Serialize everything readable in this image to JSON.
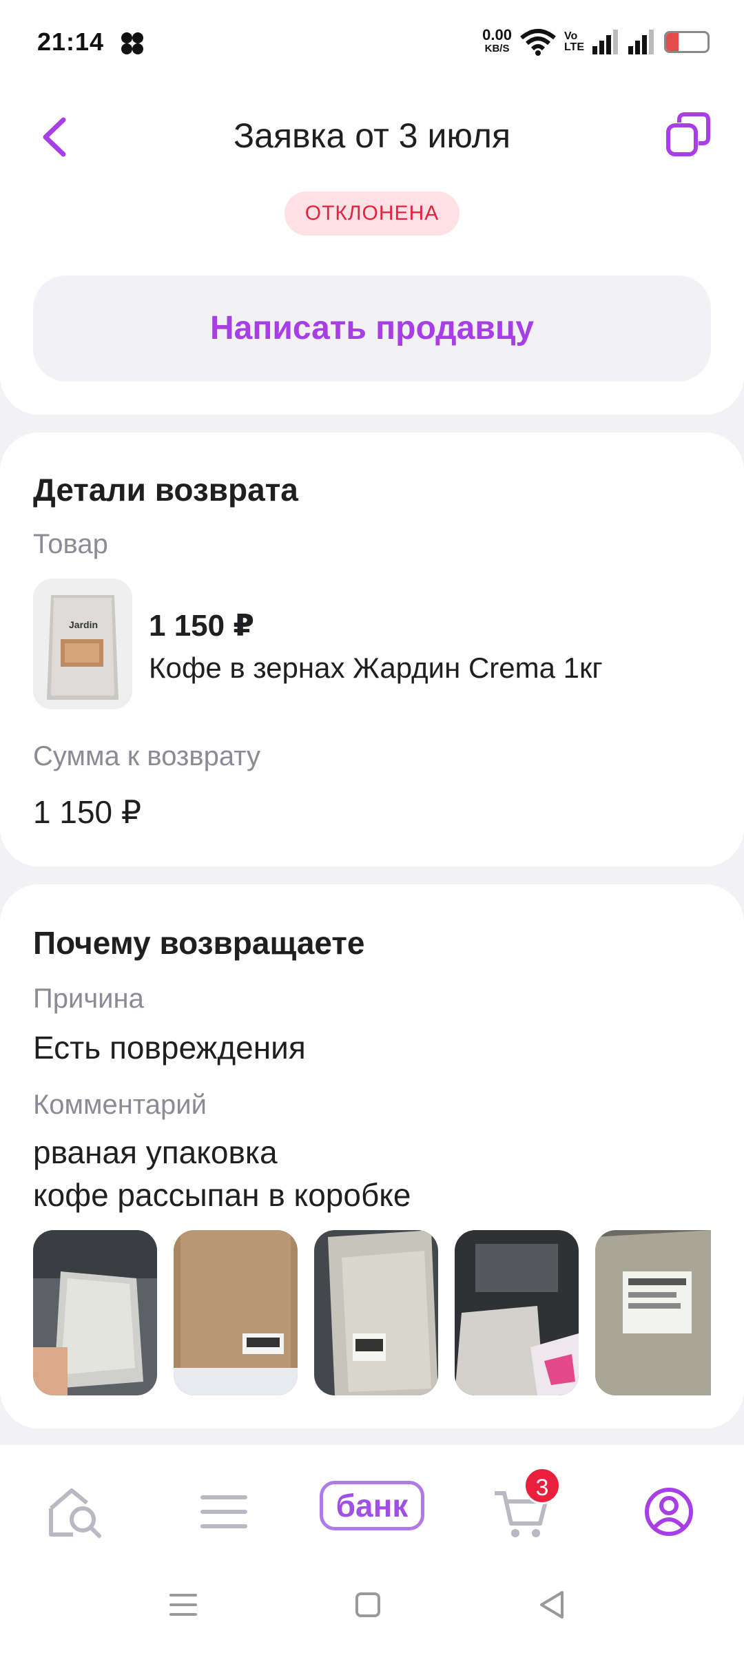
{
  "status_bar": {
    "time": "21:14",
    "net_speed": "0.00",
    "net_unit": "KB/S",
    "volte_top": "Vo",
    "volte_bottom": "LTE",
    "battery": "17"
  },
  "header": {
    "title": "Заявка от 3 июля",
    "status_badge": "ОТКЛОНЕНА",
    "write_seller_button": "Написать продавцу"
  },
  "return_details": {
    "title": "Детали возврата",
    "product_label": "Товар",
    "product_price": "1 150 ₽",
    "product_name": "Кофе в зернах Жардин Crema 1кг",
    "product_brand": "Jardin",
    "refund_label": "Сумма к возврату",
    "refund_amount": "1 150 ₽"
  },
  "reason": {
    "title": "Почему возвращаете",
    "reason_label": "Причина",
    "reason_value": "Есть повреждения",
    "comment_label": "Комментарий",
    "comment_line1": "рваная упаковка",
    "comment_line2": "кофе рассыпан в коробке",
    "photos_count": 5
  },
  "bottom_nav": {
    "items": [
      "home-search",
      "catalog",
      "bank",
      "cart",
      "profile"
    ],
    "bank_label": "банк",
    "cart_count": "3"
  },
  "colors": {
    "accent": "#a73ee6",
    "badge_text": "#e3233f",
    "badge_bg": "#fde1e4",
    "background": "#f2f2f5",
    "muted": "#8b8b96"
  }
}
